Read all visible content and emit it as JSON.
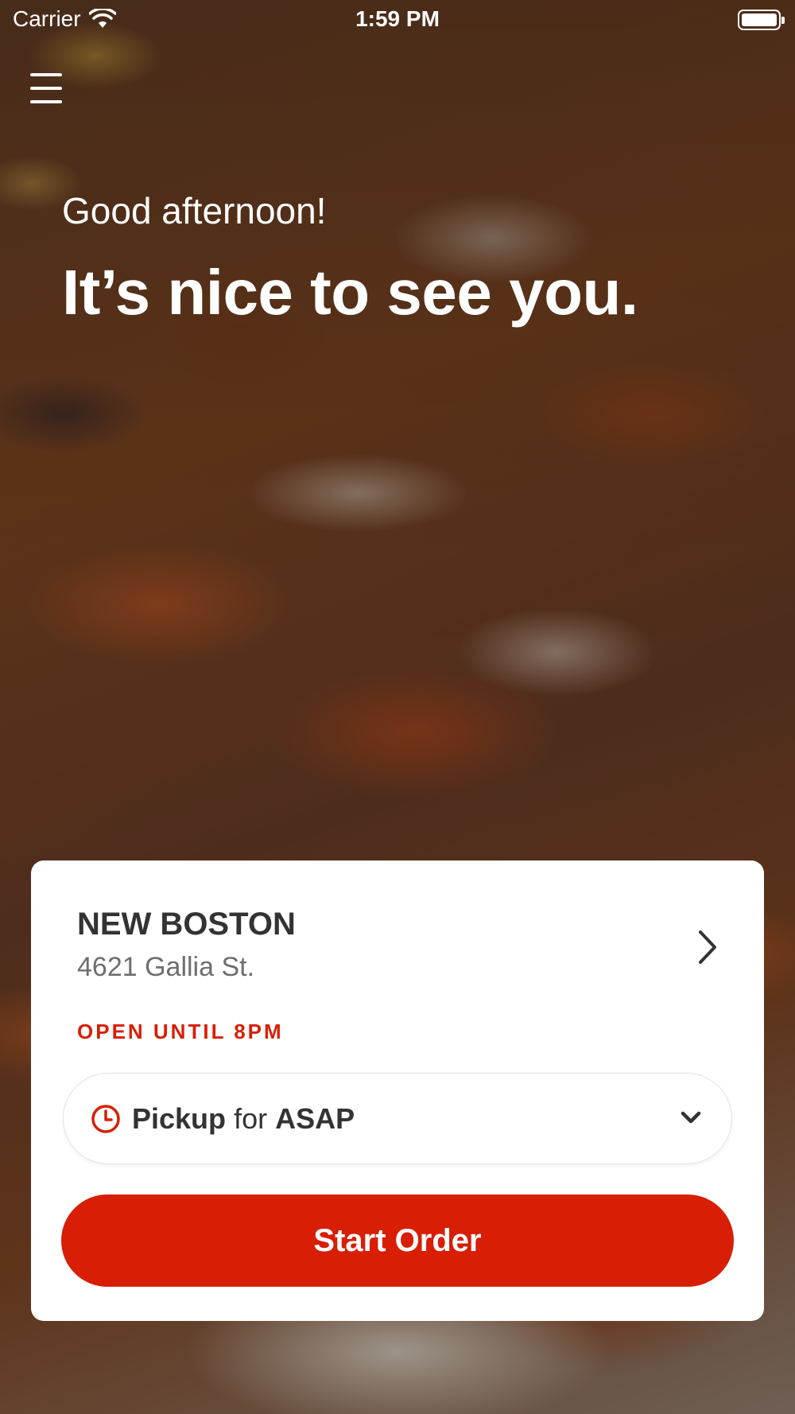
{
  "status_bar": {
    "carrier": "Carrier",
    "time": "1:59 PM"
  },
  "greeting": {
    "salutation": "Good afternoon!",
    "headline": "It’s nice to see you."
  },
  "store": {
    "name": "NEW BOSTON",
    "address": "4621 Gallia St.",
    "hours": "OPEN UNTIL 8PM"
  },
  "order_type": {
    "mode": "Pickup",
    "connector": "for",
    "time": "ASAP"
  },
  "actions": {
    "start_order_label": "Start Order"
  },
  "colors": {
    "brand_red": "#d81e05",
    "card_bg": "#ffffff",
    "text_dark": "#333333",
    "text_muted": "#6e6e6e"
  },
  "icons": [
    "wifi-icon",
    "battery-icon",
    "menu-icon",
    "chevron-right-icon",
    "clock-icon",
    "chevron-down-icon"
  ]
}
